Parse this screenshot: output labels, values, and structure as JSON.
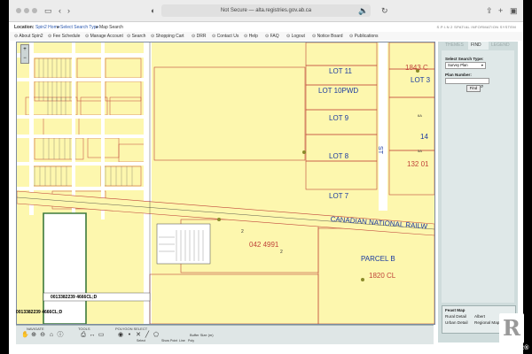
{
  "browser": {
    "url": "Not Secure — alta.registries.gov.ab.ca"
  },
  "location": {
    "label": "Location:",
    "crumbs": [
      "Spin2 Home",
      "Select Search Type",
      "Map Search"
    ],
    "separator": "►",
    "brand": "S.P.I.N 2  SPATIAL INFORMATION SYSTEM"
  },
  "nav": [
    "About Spin2",
    "Fee Schedule",
    "Manage Account",
    "Search",
    "Shopping Cart",
    "DRR",
    "Contact Us",
    "Help",
    "FAQ",
    "Logout",
    "Notice Board",
    "Publications"
  ],
  "map": {
    "lots": [
      "LOT 11",
      "LOT 10PWD",
      "LOT 9",
      "LOT 8",
      "LOT 7"
    ],
    "right_labels": [
      "1843 C",
      "LOT 3",
      "14",
      "132 01",
      "5A",
      "6A"
    ],
    "railway": "CANADIAN NATIONAL RAILW",
    "st": "ST",
    "parcel": "PARCEL B",
    "parcel_plan": "1820 CL",
    "plan_center": "042 4991",
    "two_a": "2",
    "two_b": "2",
    "popup_code": "0013382239 4666CL;D",
    "coord_readout": "0013382239 4666CL;D"
  },
  "panel": {
    "tabs": [
      "THEMES",
      "FIND",
      "LEGEND"
    ],
    "select_type_label": "Select Search Type:",
    "select_type_value": "Survey Plan",
    "plan_label": "Plan Number:",
    "find_label": "Find",
    "overview_title": "Feast Map",
    "overview_items": [
      "Rural Detail",
      "Albert",
      "Urban Detail",
      "Regional Map"
    ]
  },
  "toolbar": {
    "groups": [
      "NAVIGATE",
      "TOOLS",
      "POLYGON SELECT"
    ],
    "buttons": [
      "Pan",
      "Zoom In",
      "Zoom Out",
      "Full Extent",
      "Identify",
      "Print",
      "Measure",
      "Select",
      "Show",
      "Point",
      "Clear",
      "Line",
      "Poly"
    ],
    "buffer_label": "Buffer Size (m)"
  },
  "watermark": {
    "text": "REALTOR®"
  },
  "colors": {
    "parcel_fill": "#fdf7ae",
    "lot_lines": "#c0453a",
    "road_white": "#ffffff",
    "greenbelt": "#3d7a3b",
    "link": "#2a58b0"
  }
}
